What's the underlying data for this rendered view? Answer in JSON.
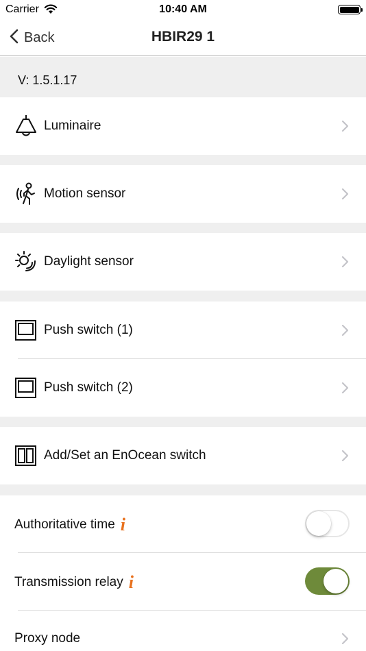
{
  "status_bar": {
    "carrier": "Carrier",
    "time": "10:40 AM"
  },
  "nav": {
    "back_label": "Back",
    "title": "HBIR29 1"
  },
  "version": "V: 1.5.1.17",
  "rows": {
    "luminaire": {
      "label": "Luminaire",
      "icon": "lamp-icon"
    },
    "motion": {
      "label": "Motion sensor",
      "icon": "motion-sensor-icon"
    },
    "daylight": {
      "label": "Daylight sensor",
      "icon": "daylight-sensor-icon"
    },
    "push1": {
      "label": "Push switch (1)",
      "icon": "push-switch-icon"
    },
    "push2": {
      "label": "Push switch (2)",
      "icon": "push-switch-icon"
    },
    "enocean": {
      "label": "Add/Set an EnOcean switch",
      "icon": "enocean-switch-icon"
    }
  },
  "settings": {
    "authoritative_time": {
      "label": "Authoritative time",
      "info": "i",
      "enabled": false
    },
    "transmission_relay": {
      "label": "Transmission relay",
      "info": "i",
      "enabled": true
    },
    "proxy_node": {
      "label": "Proxy node"
    }
  },
  "colors": {
    "accent_info": "#e8711e",
    "toggle_on": "#6e8a3a",
    "group_gap": "#efefef"
  }
}
